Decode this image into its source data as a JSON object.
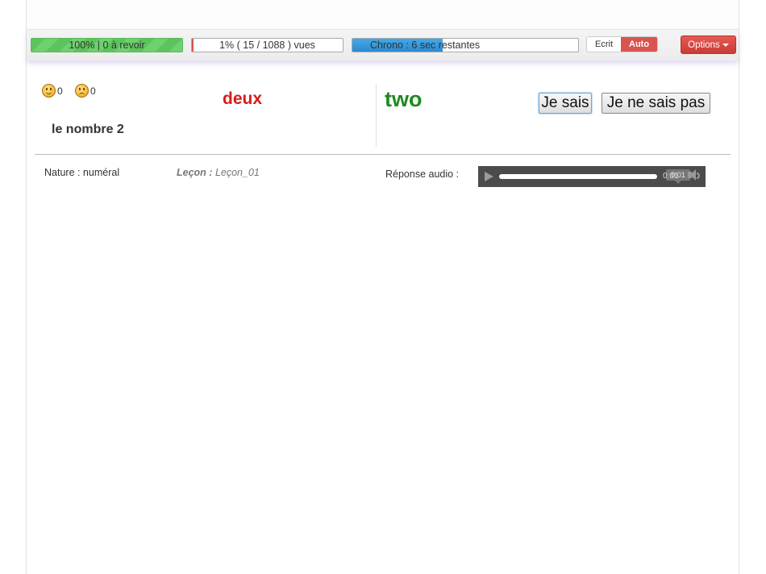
{
  "toolbar": {
    "revoir_bar": {
      "text": "100%  |  0 à revoir",
      "progress": 1.0
    },
    "vues_bar": {
      "text": "1% ( 15 / 1088 ) vues",
      "progress": 0.01
    },
    "chrono_bar": {
      "text": "Chrono : 6 sec restantes",
      "progress": 0.4
    },
    "mode_ecrit": "Ecrit",
    "mode_auto": "Auto",
    "options_label": "Options"
  },
  "scores": {
    "happy_count": "0",
    "sad_count": "0"
  },
  "card": {
    "word_fr": "deux",
    "description": "le nombre 2",
    "word_en": "two",
    "btn_know": "Je sais",
    "btn_dont_know": "Je ne sais pas"
  },
  "info": {
    "nature": "Nature : numéral",
    "lecon_label": "Leçon :",
    "lecon_value": "Leçon_01",
    "audio_label": "Réponse audio :"
  },
  "audio": {
    "tooltip_time": "0:01",
    "current_time": "0:01"
  },
  "colors": {
    "green": "#5cc45c",
    "red": "#d9534f",
    "blue": "#2a8ad0",
    "word_fr": "#d81b1b",
    "word_en": "#1f8a1f"
  }
}
